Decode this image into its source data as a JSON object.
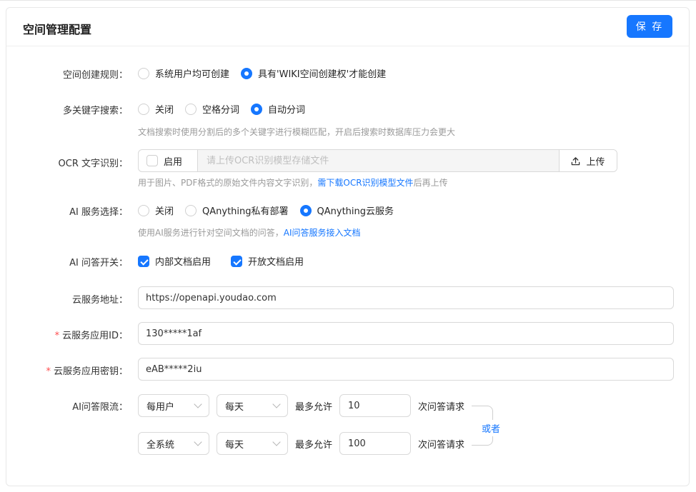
{
  "header": {
    "title": "空间管理配置",
    "save_label": "保 存"
  },
  "space_rule": {
    "label": "空间创建规则：",
    "options": [
      "系统用户均可创建",
      "具有'WIKI空间创建权'才能创建"
    ],
    "selected": 1
  },
  "keyword_search": {
    "label": "多关键字搜索：",
    "options": [
      "关闭",
      "空格分词",
      "自动分词"
    ],
    "selected": 2,
    "help": "文档搜索时使用分割后的多个关键字进行模糊匹配，开启后搜索时数据库压力会更大"
  },
  "ocr": {
    "label": "OCR 文字识别：",
    "enable_label": "启用",
    "placeholder": "请上传OCR识别模型存储文件",
    "upload_label": "上传",
    "help_prefix": "用于图片、PDF格式的原始文件内容文字识别，",
    "help_link": "需下载OCR识别模型文件",
    "help_suffix": "后再上传"
  },
  "ai_service": {
    "label": "AI 服务选择：",
    "options": [
      "关闭",
      "QAnything私有部署",
      "QAnything云服务"
    ],
    "selected": 2,
    "help_prefix": "使用AI服务进行针对空间文档的问答，",
    "help_link": "AI问答服务接入文档"
  },
  "ai_switch": {
    "label": "AI 问答开关：",
    "options": [
      "内部文档启用",
      "开放文档启用"
    ]
  },
  "cloud_address": {
    "label": "云服务地址：",
    "value": "https://openapi.youdao.com"
  },
  "cloud_app_id": {
    "label": "云服务应用ID：",
    "value": "130*****1af"
  },
  "cloud_app_secret": {
    "label": "云服务应用密钥：",
    "value": "eAB*****2iu"
  },
  "rate_limit": {
    "label": "AI问答限流：",
    "max_allow": "最多允许",
    "suffix": "次问答请求",
    "or_label": "或者",
    "rules": [
      {
        "scope": "每用户",
        "period": "每天",
        "count": "10"
      },
      {
        "scope": "全系统",
        "period": "每天",
        "count": "100"
      }
    ]
  },
  "colors": {
    "accent": "#1677ff",
    "required": "#ff4d4f"
  }
}
